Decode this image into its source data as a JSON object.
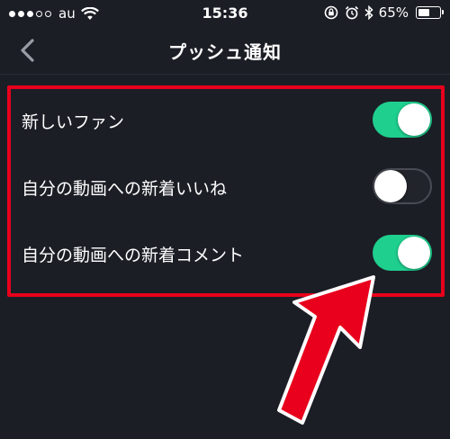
{
  "status_bar": {
    "carrier": "au",
    "time": "15:36",
    "battery_percent": "65%",
    "battery_level": 0.65,
    "icons": [
      "signal-dots",
      "wifi-icon",
      "orientation-lock-icon",
      "alarm-icon",
      "bluetooth-icon",
      "battery-icon"
    ]
  },
  "nav": {
    "title": "プッシュ通知",
    "back_icon": "chevron-left-icon"
  },
  "settings": [
    {
      "label": "新しいファン",
      "enabled": true
    },
    {
      "label": "自分の動画への新着いいね",
      "enabled": false
    },
    {
      "label": "自分の動画への新着コメント",
      "enabled": true
    }
  ],
  "colors": {
    "background": "#1c1e26",
    "toggle_on": "#1fcf8e",
    "toggle_off_border": "#4a4c55",
    "highlight": "#e8001c",
    "text": "#ffffff"
  }
}
